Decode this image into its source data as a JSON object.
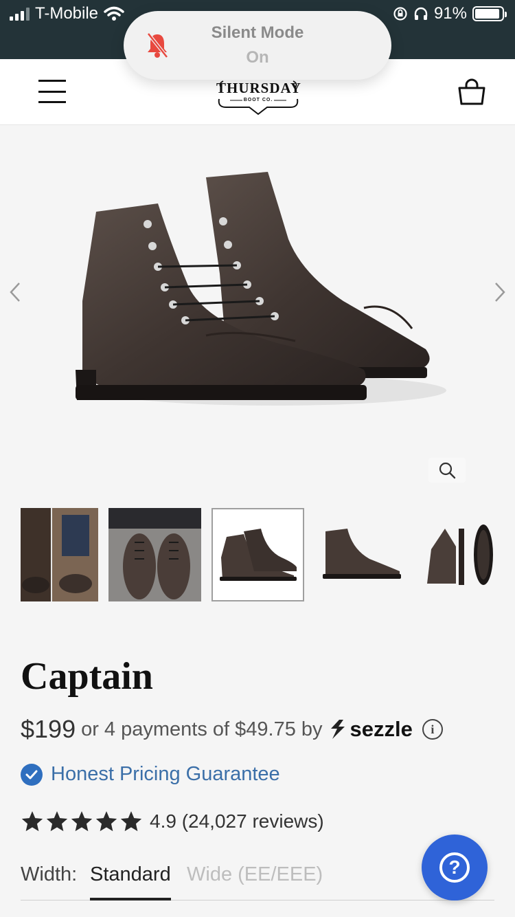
{
  "status_bar": {
    "carrier": "T-Mobile",
    "battery_percent": "91%",
    "battery_level": 0.91
  },
  "silent_toast": {
    "title": "Silent Mode",
    "state": "On"
  },
  "header": {
    "logo_text": "THURSDAY",
    "logo_sub": "BOOT CO."
  },
  "colors": {
    "status_bar_bg": "#233338",
    "accent_blue": "#2f63d8",
    "link_blue": "#3b6fa8",
    "silent_icon_red": "#e8493f"
  },
  "icons": [
    "menu-icon",
    "shopping-bag-icon",
    "chevron-left-icon",
    "chevron-right-icon",
    "magnifier-icon",
    "checkmark-badge-icon",
    "star-icon",
    "info-icon",
    "question-icon",
    "silent-bell-icon"
  ],
  "product": {
    "title": "Captain",
    "price": "$199",
    "installments": "or 4 payments of $49.75 by",
    "sezzle": "sezzle",
    "info_glyph": "i",
    "guarantee": "Honest Pricing Guarantee",
    "rating_value": "4.9",
    "rating_text": "4.9 (24,027 reviews)",
    "stars": 5
  },
  "width": {
    "label": "Width:",
    "selected": "Standard",
    "options": [
      "Standard",
      "Wide (EE/EEE)"
    ]
  },
  "help": {
    "glyph": "?"
  }
}
